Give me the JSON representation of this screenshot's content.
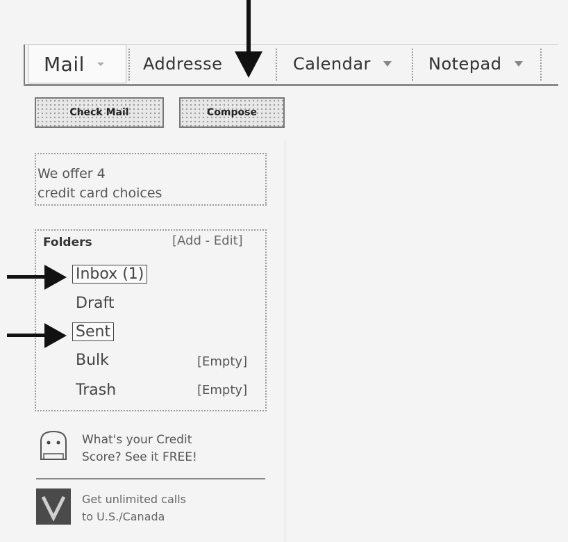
{
  "tabs": [
    {
      "label": "Mail"
    },
    {
      "label": "Addresse"
    },
    {
      "label": "Calendar"
    },
    {
      "label": "Notepad"
    }
  ],
  "toolbar": {
    "check_mail_label": "Check Mail",
    "compose_label": "Compose"
  },
  "promo": {
    "line1": "We offer 4",
    "line2": "credit card choices"
  },
  "folders": {
    "title": "Folders",
    "actions": "[Add - Edit]",
    "items": [
      {
        "label": "Inbox (1)"
      },
      {
        "label": "Draft"
      },
      {
        "label": "Sent"
      },
      {
        "label": "Bulk",
        "action": "[Empty]"
      },
      {
        "label": "Trash",
        "action": "[Empty]"
      }
    ]
  },
  "ads": {
    "credit_line1": "What's your Credit",
    "credit_line2": "Score? See it FREE!",
    "calls_line1": "Get unlimited calls",
    "calls_line2": "to U.S./Canada"
  },
  "icons": {
    "tab_dropdown": "chevron-down-icon",
    "annotation": "arrow-icon",
    "credit_ad": "ghost-icon",
    "calls_ad": "v-logo-icon"
  }
}
